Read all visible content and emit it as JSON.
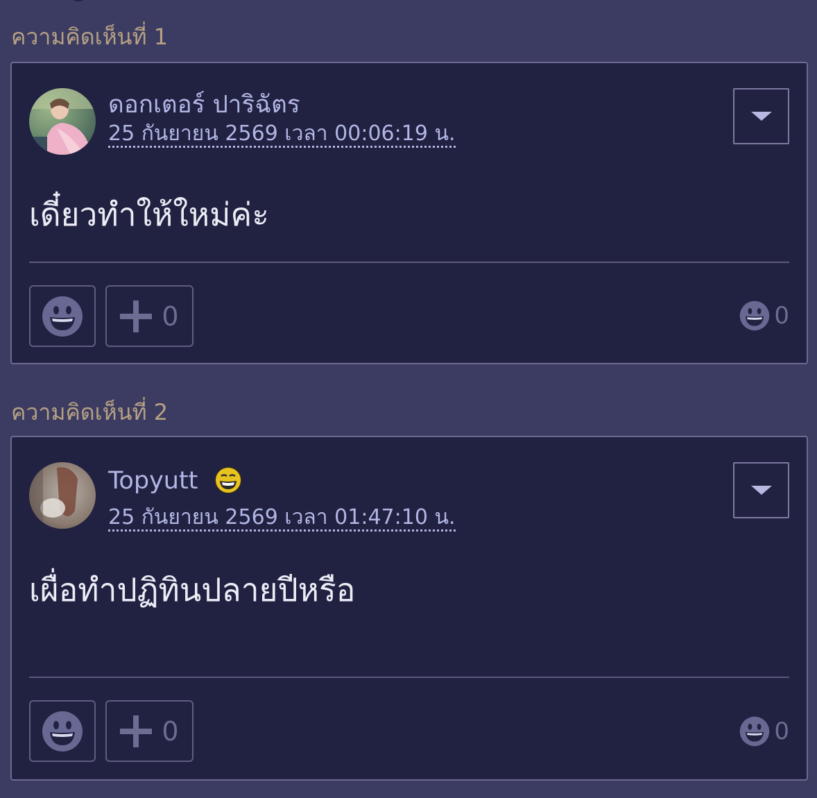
{
  "comments": [
    {
      "heading": "ความคิดเห็นที่ 1",
      "author": "ดอกเตอร์ ปาริฉัตร",
      "timestamp": "25 กันยายน 2569 เวลา 00:06:19 น.",
      "body": "เดี๋ยวทำให้ใหม่ค่ะ",
      "plus_count": "0",
      "reaction_total": "0",
      "author_badge": null,
      "icons": {
        "avatar": "author-avatar-photo",
        "menu": "chevron-down-icon",
        "react": "smiley-face-icon",
        "plus": "plus-icon",
        "total": "smiley-face-icon"
      }
    },
    {
      "heading": "ความคิดเห็นที่ 2",
      "author": "Topyutt",
      "timestamp": "25 กันยายน 2569 เวลา 01:47:10 น.",
      "body": "เผื่อทำปฏิทินปลายปีหรือ",
      "plus_count": "0",
      "reaction_total": "0",
      "author_badge": "grinning-emoji-icon",
      "icons": {
        "avatar": "author-avatar-photo",
        "menu": "chevron-down-icon",
        "react": "smiley-face-icon",
        "plus": "plus-icon",
        "total": "smiley-face-icon"
      }
    }
  ],
  "colors": {
    "page_background": "#3c3b62",
    "card_background": "#212141",
    "heading_text": "#b6a183",
    "author_link": "#b1b7e4",
    "body_text": "#ececf6",
    "muted_icon": "#6c6d92"
  }
}
